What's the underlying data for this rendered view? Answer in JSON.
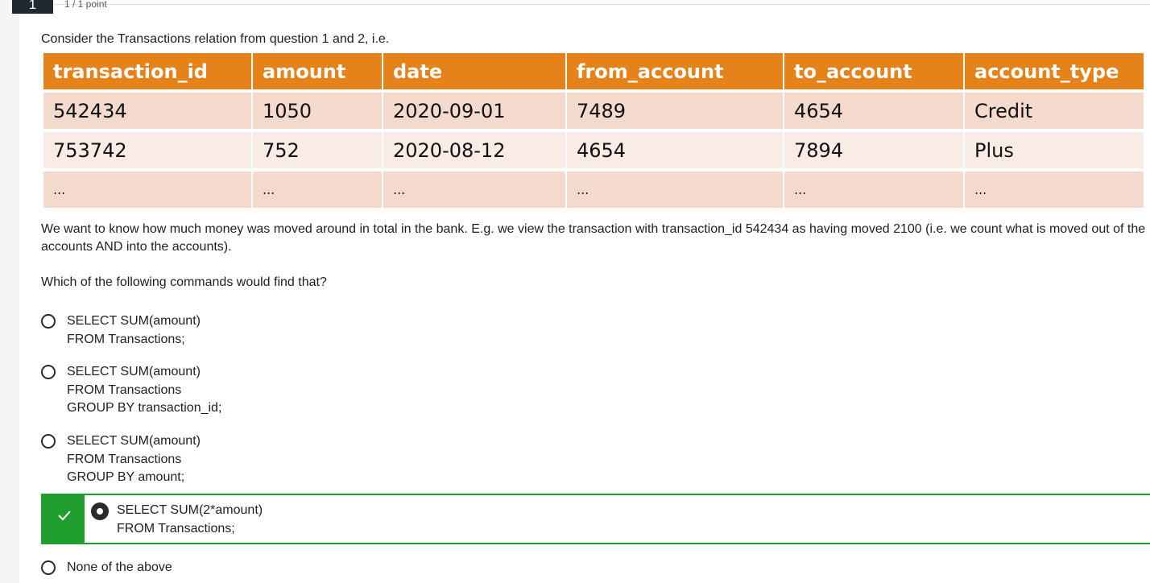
{
  "header": {
    "question_number": "1",
    "points": "1 / 1 point"
  },
  "prompt": "Consider the Transactions relation from question 1 and 2, i.e.",
  "table": {
    "columns": [
      "transaction_id",
      "amount",
      "date",
      "from_account",
      "to_account",
      "account_type"
    ],
    "rows": [
      [
        "542434",
        "1050",
        "2020-09-01",
        "7489",
        "4654",
        "Credit"
      ],
      [
        "753742",
        "752",
        "2020-08-12",
        "4654",
        "7894",
        "Plus"
      ],
      [
        "...",
        "...",
        "...",
        "...",
        "...",
        "..."
      ]
    ]
  },
  "explanation": "We want to know how much money was moved around in total in the bank. E.g. we view the transaction with transaction_id 542434 as having moved 2100 (i.e. we count what is moved out of the accounts AND into the accounts).",
  "question": "Which of the following commands would find that?",
  "options": [
    {
      "lines": [
        "SELECT SUM(amount)",
        "FROM Transactions;"
      ]
    },
    {
      "lines": [
        "SELECT SUM(amount)",
        "FROM Transactions",
        "GROUP BY transaction_id;"
      ]
    },
    {
      "lines": [
        "SELECT SUM(amount)",
        "FROM Transactions",
        "GROUP BY amount;"
      ]
    },
    {
      "lines": [
        "SELECT SUM(2*amount)",
        "FROM Transactions;"
      ],
      "selected": true,
      "correct": true
    },
    {
      "lines": [
        "None of the above"
      ]
    }
  ],
  "colors": {
    "header_orange": "#e6821a",
    "row_light": "#f9ebe5",
    "row_dark": "#f4d9cd",
    "correct_green": "#1f9d2e"
  },
  "icons": {
    "correct": "checkmark-icon"
  }
}
